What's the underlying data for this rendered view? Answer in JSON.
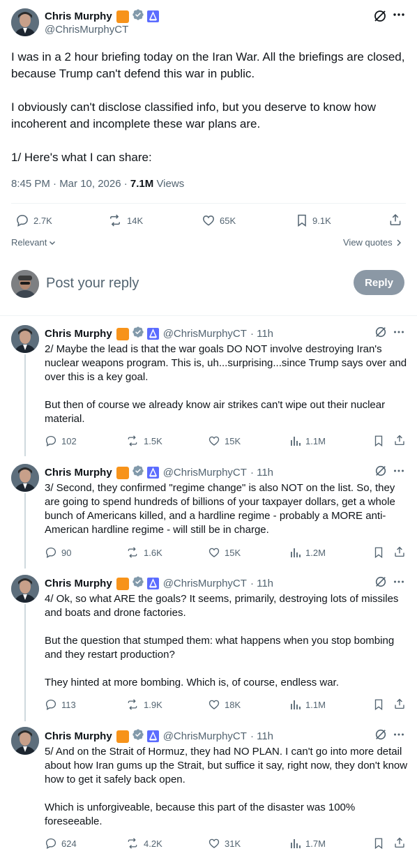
{
  "main": {
    "name": "Chris Murphy",
    "handle": "@ChrisMurphyCT",
    "paragraphs": [
      "I was in a 2 hour briefing today on the Iran War. All the briefings are closed, because Trump can't defend this war in public.",
      "I obviously can't disclose classified info, but you deserve to know how incoherent and incomplete these war plans are.",
      "1/ Here's what I can share:"
    ],
    "timestamp": "8:45 PM · Mar 10, 2026 · ",
    "views_count": "7.1M",
    "views_label": " Views",
    "stats": {
      "replies": "2.7K",
      "reposts": "14K",
      "likes": "65K",
      "bookmarks": "9.1K"
    },
    "relevant_label": "Relevant",
    "view_quotes_label": "View quotes"
  },
  "composer": {
    "placeholder": "Post your reply",
    "reply_label": "Reply"
  },
  "replies": [
    {
      "name": "Chris Murphy",
      "handle": "@ChrisMurphyCT",
      "time": "· 11h",
      "text": "2/ Maybe the lead is that the war goals DO NOT involve destroying Iran's nuclear weapons program. This is, uh...surprising...since Trump says over and over this is a key goal.\n\nBut then of course we already know air strikes can't wipe out their nuclear material.",
      "stats": {
        "replies": "102",
        "reposts": "1.5K",
        "likes": "15K",
        "views": "1.1M"
      }
    },
    {
      "name": "Chris Murphy",
      "handle": "@ChrisMurphyCT",
      "time": "· 11h",
      "text": "3/ Second, they confirmed \"regime change\" is also NOT on the list. So, they are going to spend hundreds of billions of your taxpayer dollars, get a whole bunch of Americans killed, and a hardline regime - probably a MORE anti-American hardline regime - will still be in charge.",
      "stats": {
        "replies": "90",
        "reposts": "1.6K",
        "likes": "15K",
        "views": "1.2M"
      }
    },
    {
      "name": "Chris Murphy",
      "handle": "@ChrisMurphyCT",
      "time": "· 11h",
      "text": "4/ Ok, so what ARE the goals? It seems, primarily, destroying lots of missiles and boats and drone factories.\n\nBut the question that stumped them: what happens when you stop bombing and they restart production?\n\nThey hinted at more bombing. Which is, of course, endless war.",
      "stats": {
        "replies": "113",
        "reposts": "1.9K",
        "likes": "18K",
        "views": "1.1M"
      }
    },
    {
      "name": "Chris Murphy",
      "handle": "@ChrisMurphyCT",
      "time": "· 11h",
      "text": "5/ And on the Strait of Hormuz, they had NO PLAN. I can't go into more detail about how Iran gums up the Strait, but suffice it say, right now, they don't know how to get it safely back open.\n\nWhich is unforgiveable, because this part of the disaster was 100% foreseeable.",
      "stats": {
        "replies": "624",
        "reposts": "4.2K",
        "likes": "31K",
        "views": "1.7M"
      }
    }
  ],
  "colors": {
    "accent": "#1d9bf0",
    "gray": "#536471",
    "gold_badge": "#f7931a",
    "blue_badge": "#5b6cff"
  },
  "icons": [
    "grok-icon",
    "more-icon",
    "reply-icon",
    "repost-icon",
    "like-icon",
    "bookmark-icon",
    "share-icon",
    "views-icon",
    "chevron-down-icon",
    "chevron-right-icon",
    "verified-icon",
    "senate-badge-icon"
  ]
}
